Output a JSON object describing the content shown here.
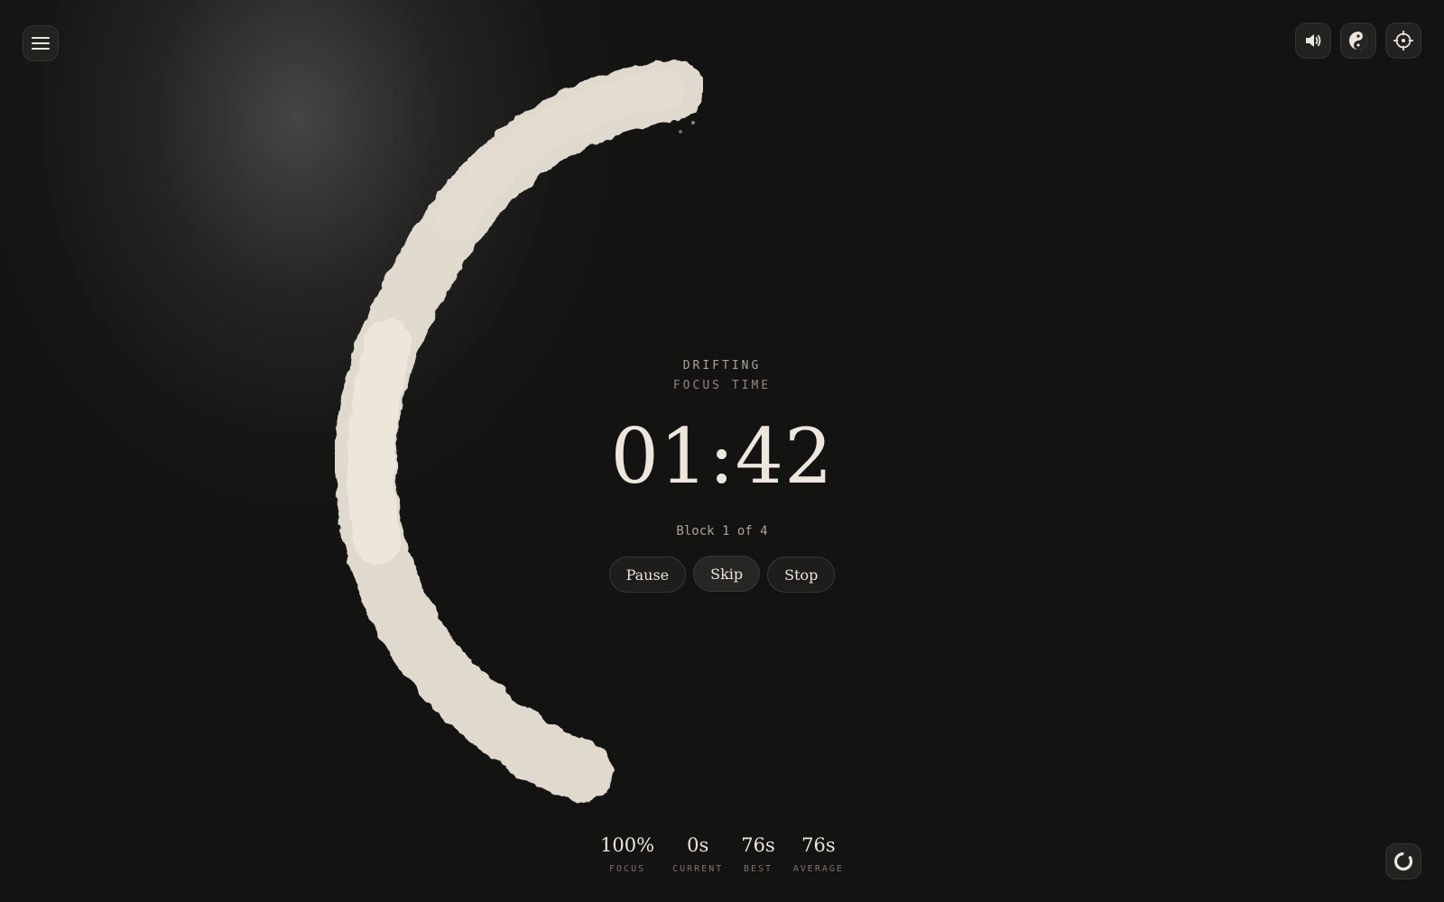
{
  "colors": {
    "background": "#131312",
    "ink": "#ece6dc",
    "muted": "#8f887e",
    "button_bg": "#222221"
  },
  "toolbar": {
    "menu_icon": "menu-icon",
    "sound_icon": "speaker-icon",
    "theme_icon": "yin-yang-icon",
    "focus_icon": "crosshair-icon",
    "ring_icon": "ring-icon"
  },
  "session": {
    "state": "DRIFTING",
    "mode": "FOCUS TIME",
    "timer": "01:42",
    "block": "Block 1 of 4",
    "progress": 0.43
  },
  "controls": {
    "pause": "Pause",
    "skip": "Skip",
    "stop": "Stop"
  },
  "stats": [
    {
      "value": "100%",
      "label": "FOCUS"
    },
    {
      "value": "0s",
      "label": "CURRENT"
    },
    {
      "value": "76s",
      "label": "BEST"
    },
    {
      "value": "76s",
      "label": "AVERAGE"
    }
  ]
}
